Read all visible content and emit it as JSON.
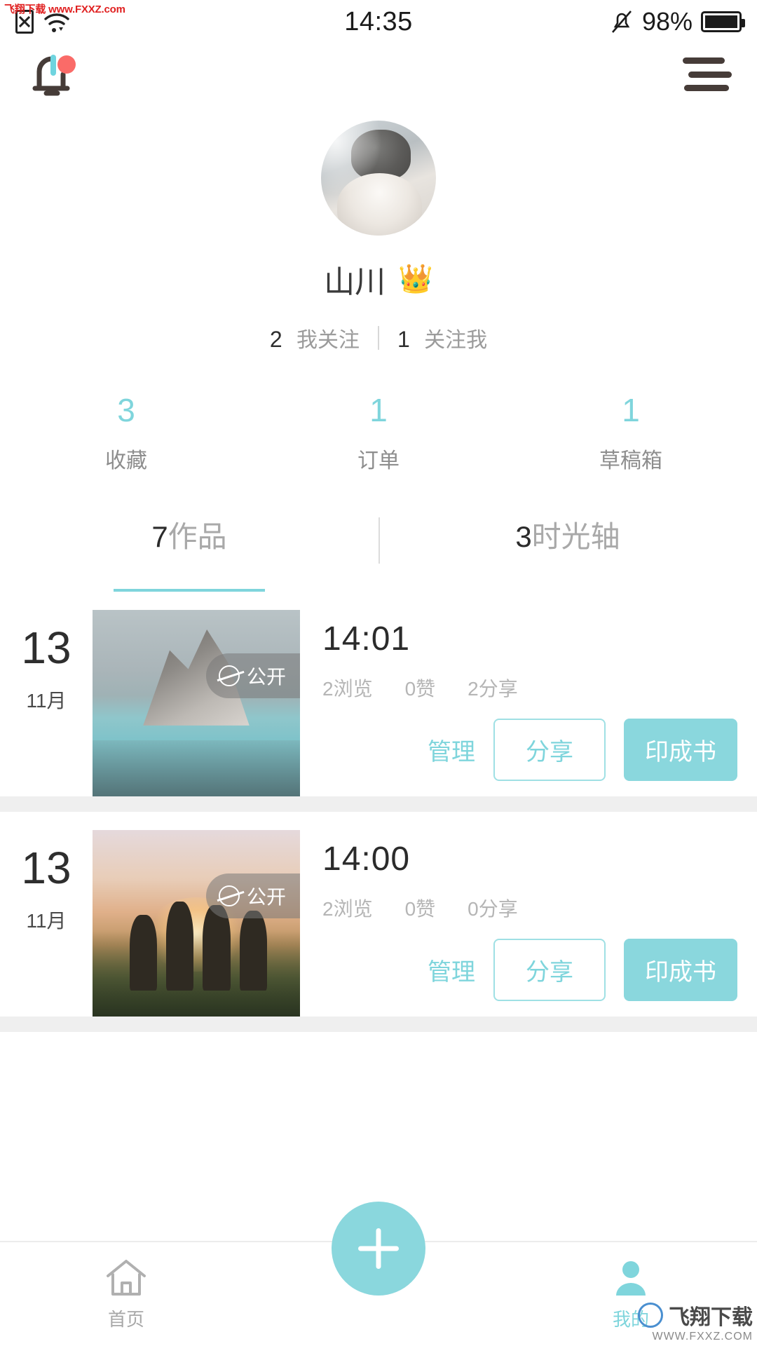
{
  "statusbar": {
    "time": "14:35",
    "battery": "98%",
    "sim_icon": "sim-card-x-icon",
    "wifi_icon": "wifi-icon",
    "mute_icon": "bell-muted-icon",
    "battery_icon": "battery-full-icon",
    "watermark": "飞翔下载 www.FXXZ.com"
  },
  "header": {
    "notification_icon": "bell-icon",
    "notification_badge": "",
    "menu_icon": "hamburger-menu-icon"
  },
  "profile": {
    "avatar_alt": "user-avatar-cat-photo",
    "name": "山川",
    "vip_icon": "👑",
    "following_count": "2",
    "following_label": "我关注",
    "followers_count": "1",
    "followers_label": "关注我"
  },
  "stats": [
    {
      "value": "3",
      "label": "收藏"
    },
    {
      "value": "1",
      "label": "订单"
    },
    {
      "value": "1",
      "label": "草稿箱"
    }
  ],
  "tabs": [
    {
      "count": "7",
      "label": "作品",
      "active": true
    },
    {
      "count": "3",
      "label": "时光轴",
      "active": false
    }
  ],
  "colors": {
    "accent": "#7fd5dc",
    "accent_fill": "#8ad7dd",
    "text_dark": "#2b2b2b",
    "text_muted": "#b5b5b5",
    "badge_red": "#fa6b68"
  },
  "cards": [
    {
      "day": "13",
      "month": "11月",
      "privacy_icon": "globe-icon",
      "privacy": "公开",
      "time": "14:01",
      "views": "2浏览",
      "likes": "0赞",
      "shares": "2分享",
      "manage_label": "管理",
      "share_label": "分享",
      "print_label": "印成书",
      "thumb_alt": "snow-mountain-lake-photo"
    },
    {
      "day": "13",
      "month": "11月",
      "privacy_icon": "globe-icon",
      "privacy": "公开",
      "time": "14:00",
      "views": "2浏览",
      "likes": "0赞",
      "shares": "0分享",
      "manage_label": "管理",
      "share_label": "分享",
      "print_label": "印成书",
      "thumb_alt": "friends-sunset-photo"
    }
  ],
  "bottomnav": {
    "home_icon": "home-icon",
    "home_label": "首页",
    "add_icon": "plus-icon",
    "profile_icon": "person-icon",
    "profile_label": "我的"
  },
  "footer_brand": {
    "name": "飞翔下载",
    "url": "WWW.FXXZ.COM"
  }
}
